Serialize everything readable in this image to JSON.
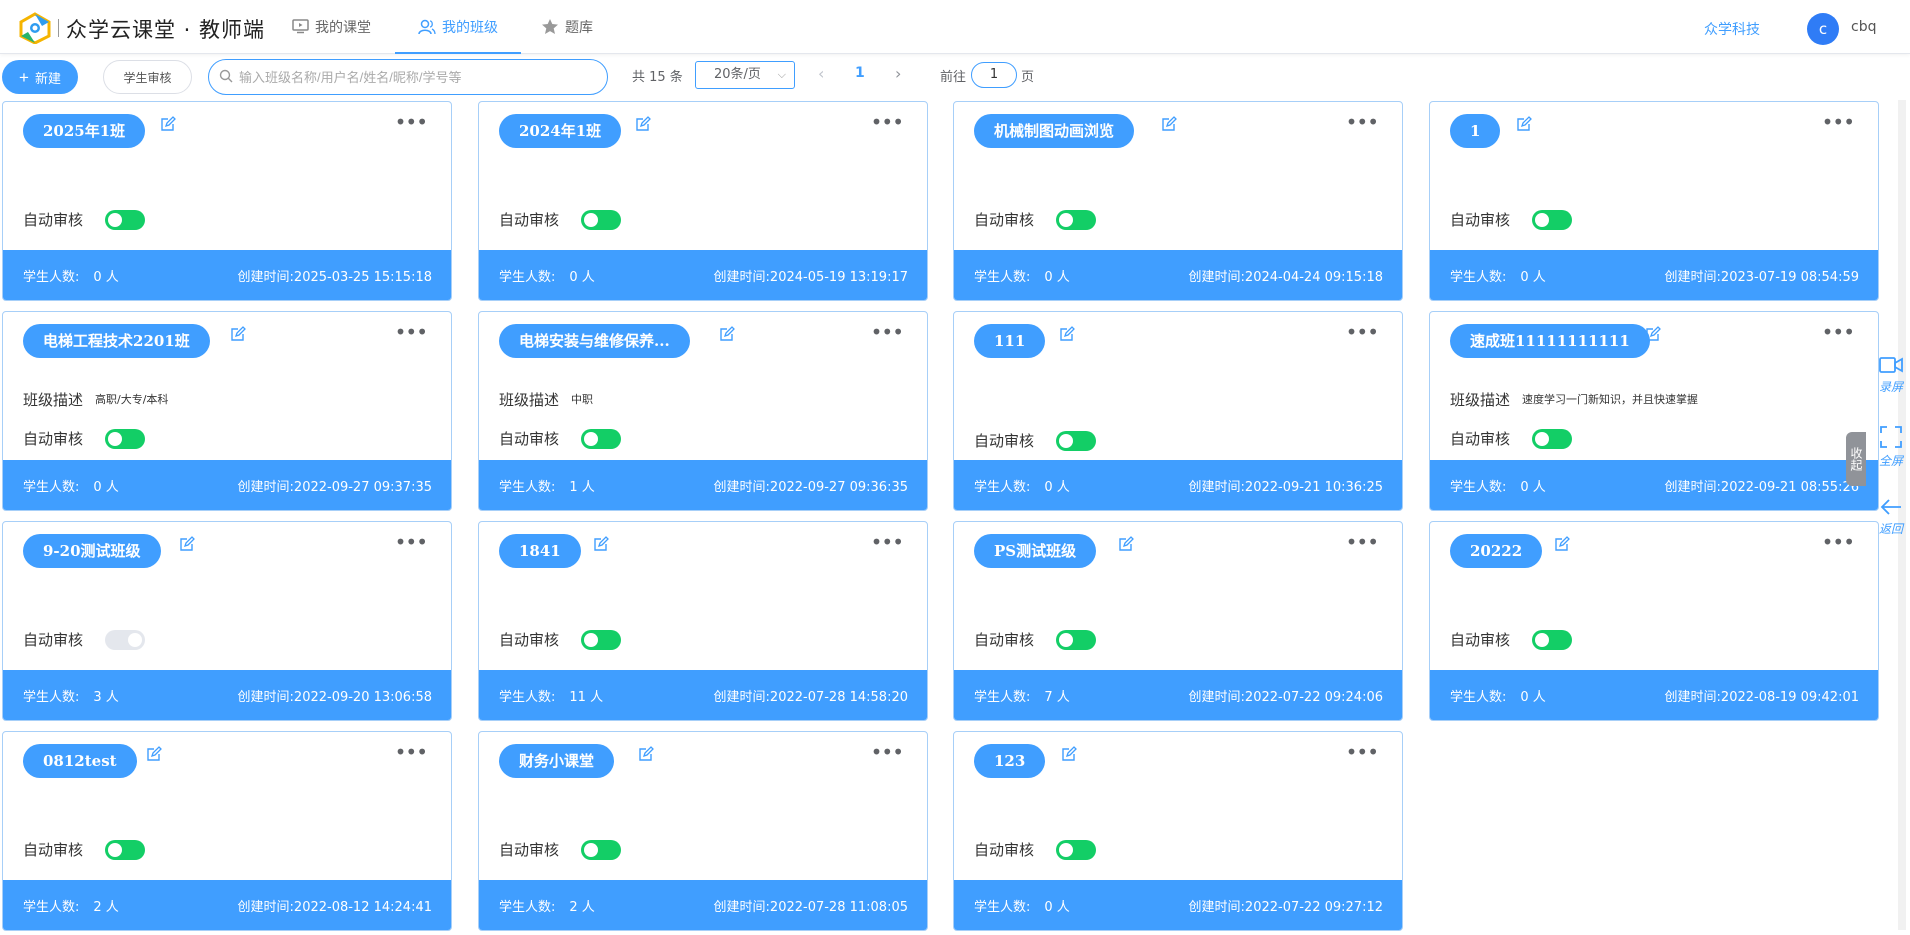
{
  "header": {
    "brand": "众学云课堂 · 教师端",
    "nav": [
      {
        "label": "我的课堂",
        "active": false,
        "icon": "monitor-icon"
      },
      {
        "label": "我的班级",
        "active": true,
        "icon": "user-group-icon"
      },
      {
        "label": "题库",
        "active": false,
        "icon": "star-icon"
      }
    ],
    "company": "众学科技",
    "avatar_initial": "c",
    "username": "cbq"
  },
  "toolbar": {
    "new_label": "新建",
    "review_label": "学生审核",
    "search_placeholder": "输入班级名称/用户名/姓名/昵称/学号等",
    "total": "共 15 条",
    "page_size": "20条/页",
    "current_page": "1",
    "goto_label": "前往",
    "goto_value": "1",
    "goto_suffix": "页"
  },
  "labels": {
    "auto_review": "自动审核",
    "description": "班级描述",
    "students": "学生人数:",
    "created": "创建时间:"
  },
  "classes": [
    {
      "name": "2025年1班",
      "description": "",
      "auto_review": true,
      "students": "0 人",
      "created": "2025-03-25 15:15:18"
    },
    {
      "name": "2024年1班",
      "description": "",
      "auto_review": true,
      "students": "0 人",
      "created": "2024-05-19 13:19:17"
    },
    {
      "name": "机械制图动画浏览",
      "description": "",
      "auto_review": true,
      "students": "0 人",
      "created": "2024-04-24 09:15:18"
    },
    {
      "name": "1",
      "description": "",
      "auto_review": true,
      "students": "0 人",
      "created": "2023-07-19 08:54:59"
    },
    {
      "name": "电梯工程技术2201班",
      "description": "高职/大专/本科",
      "auto_review": true,
      "students": "0 人",
      "created": "2022-09-27 09:37:35"
    },
    {
      "name": "电梯安装与维修保养...",
      "description": "中职",
      "auto_review": true,
      "students": "1 人",
      "created": "2022-09-27 09:36:35"
    },
    {
      "name": "111",
      "description": "",
      "auto_review": true,
      "students": "0 人",
      "created": "2022-09-21 10:36:25"
    },
    {
      "name": "速成班11111111111",
      "description": "速度学习一门新知识，并且快速掌握",
      "auto_review": true,
      "students": "0 人",
      "created": "2022-09-21 08:55:26"
    },
    {
      "name": "9-20测试班级",
      "description": "",
      "auto_review": false,
      "students": "3 人",
      "created": "2022-09-20 13:06:58"
    },
    {
      "name": "1841",
      "description": "",
      "auto_review": true,
      "students": "11 人",
      "created": "2022-07-28 14:58:20"
    },
    {
      "name": "PS测试班级",
      "description": "",
      "auto_review": true,
      "students": "7 人",
      "created": "2022-07-22 09:24:06"
    },
    {
      "name": "20222",
      "description": "",
      "auto_review": true,
      "students": "0 人",
      "created": "2022-08-19 09:42:01"
    },
    {
      "name": "0812test",
      "description": "",
      "auto_review": true,
      "students": "2 人",
      "created": "2022-08-12 14:24:41"
    },
    {
      "name": "财务小课堂",
      "description": "",
      "auto_review": true,
      "students": "2 人",
      "created": "2022-07-28 11:08:05"
    },
    {
      "name": "123",
      "description": "",
      "auto_review": true,
      "students": "0 人",
      "created": "2022-07-22 09:27:12"
    }
  ],
  "side_tools": {
    "record": "录屏",
    "fullscreen": "全屏",
    "back": "返回",
    "collapse": "收起"
  },
  "colors": {
    "primary": "#409eff",
    "switch_on": "#13ce66",
    "switch_off": "#e4e7ed"
  }
}
